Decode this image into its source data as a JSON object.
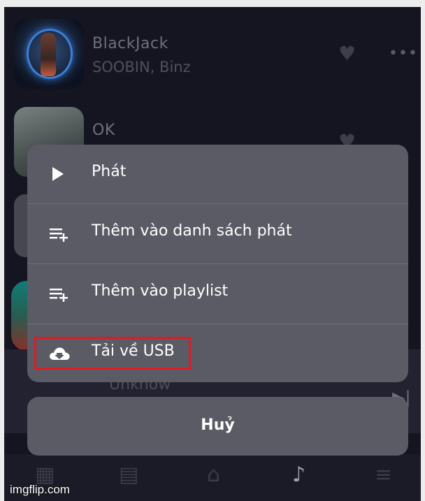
{
  "songs": [
    {
      "title": "BlackJack",
      "artist": "SOOBIN, Binz"
    },
    {
      "title": "OK",
      "artist": ""
    }
  ],
  "player": {
    "track_text": "Unknow"
  },
  "menu": {
    "items": [
      {
        "label": "Phát",
        "icon": "play-icon"
      },
      {
        "label": "Thêm vào danh sách phát",
        "icon": "queue-add-icon"
      },
      {
        "label": "Thêm vào playlist",
        "icon": "playlist-add-icon"
      },
      {
        "label": "Tải về USB",
        "icon": "cloud-download-icon"
      }
    ],
    "cancel_label": "Huỷ"
  },
  "nav": [
    "grid-icon",
    "list-icon",
    "home-icon",
    "music-note-icon",
    "menu-icon"
  ],
  "watermark": "imgflip.com",
  "colors": {
    "highlight": "#e01b24",
    "menu_bg": "#5a5b64",
    "screen_bg": "#151521"
  }
}
